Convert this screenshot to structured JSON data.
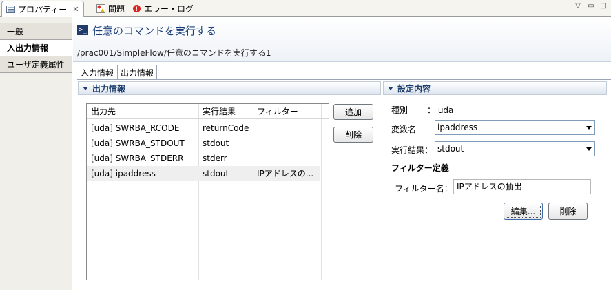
{
  "view_tabs": [
    {
      "label": "プロパティー",
      "icon": "properties-icon",
      "active": true
    },
    {
      "label": "問題",
      "icon": "problems-icon",
      "active": false
    },
    {
      "label": "エラー・ログ",
      "icon": "error-log-icon",
      "active": false
    }
  ],
  "categories": [
    "一般",
    "入出力情報",
    "ユーザ定義属性"
  ],
  "selected_category": "入出力情報",
  "header": {
    "title": "任意のコマンドを実行する",
    "path": "/prac001/SimpleFlow/任意のコマンドを実行する1"
  },
  "sub_tabs": [
    "入力情報",
    "出力情報"
  ],
  "output_section": {
    "title": "出力情報",
    "columns": [
      "出力先",
      "実行結果",
      "フィルター"
    ],
    "rows": [
      {
        "dest": "[uda] SWRBA_RCODE",
        "result": "returnCode",
        "filter": ""
      },
      {
        "dest": "[uda] SWRBA_STDOUT",
        "result": "stdout",
        "filter": ""
      },
      {
        "dest": "[uda] SWRBA_STDERR",
        "result": "stderr",
        "filter": ""
      },
      {
        "dest": "[uda] ipaddress",
        "result": "stdout",
        "filter": "IPアドレスの..."
      }
    ],
    "add_label": "追加",
    "delete_label": "削除"
  },
  "settings_section": {
    "title": "設定内容",
    "type_label": "種別",
    "type_value": "： uda",
    "var_label": "変数名",
    "var_value": "ipaddress",
    "result_label": "実行結果：",
    "result_value": "stdout",
    "filter_def_label": "フィルター定義",
    "filter_name_label": "フィルター名：",
    "filter_name_value": "IPアドレスの抽出",
    "edit_label": "編集...",
    "delete_label": "削除"
  }
}
